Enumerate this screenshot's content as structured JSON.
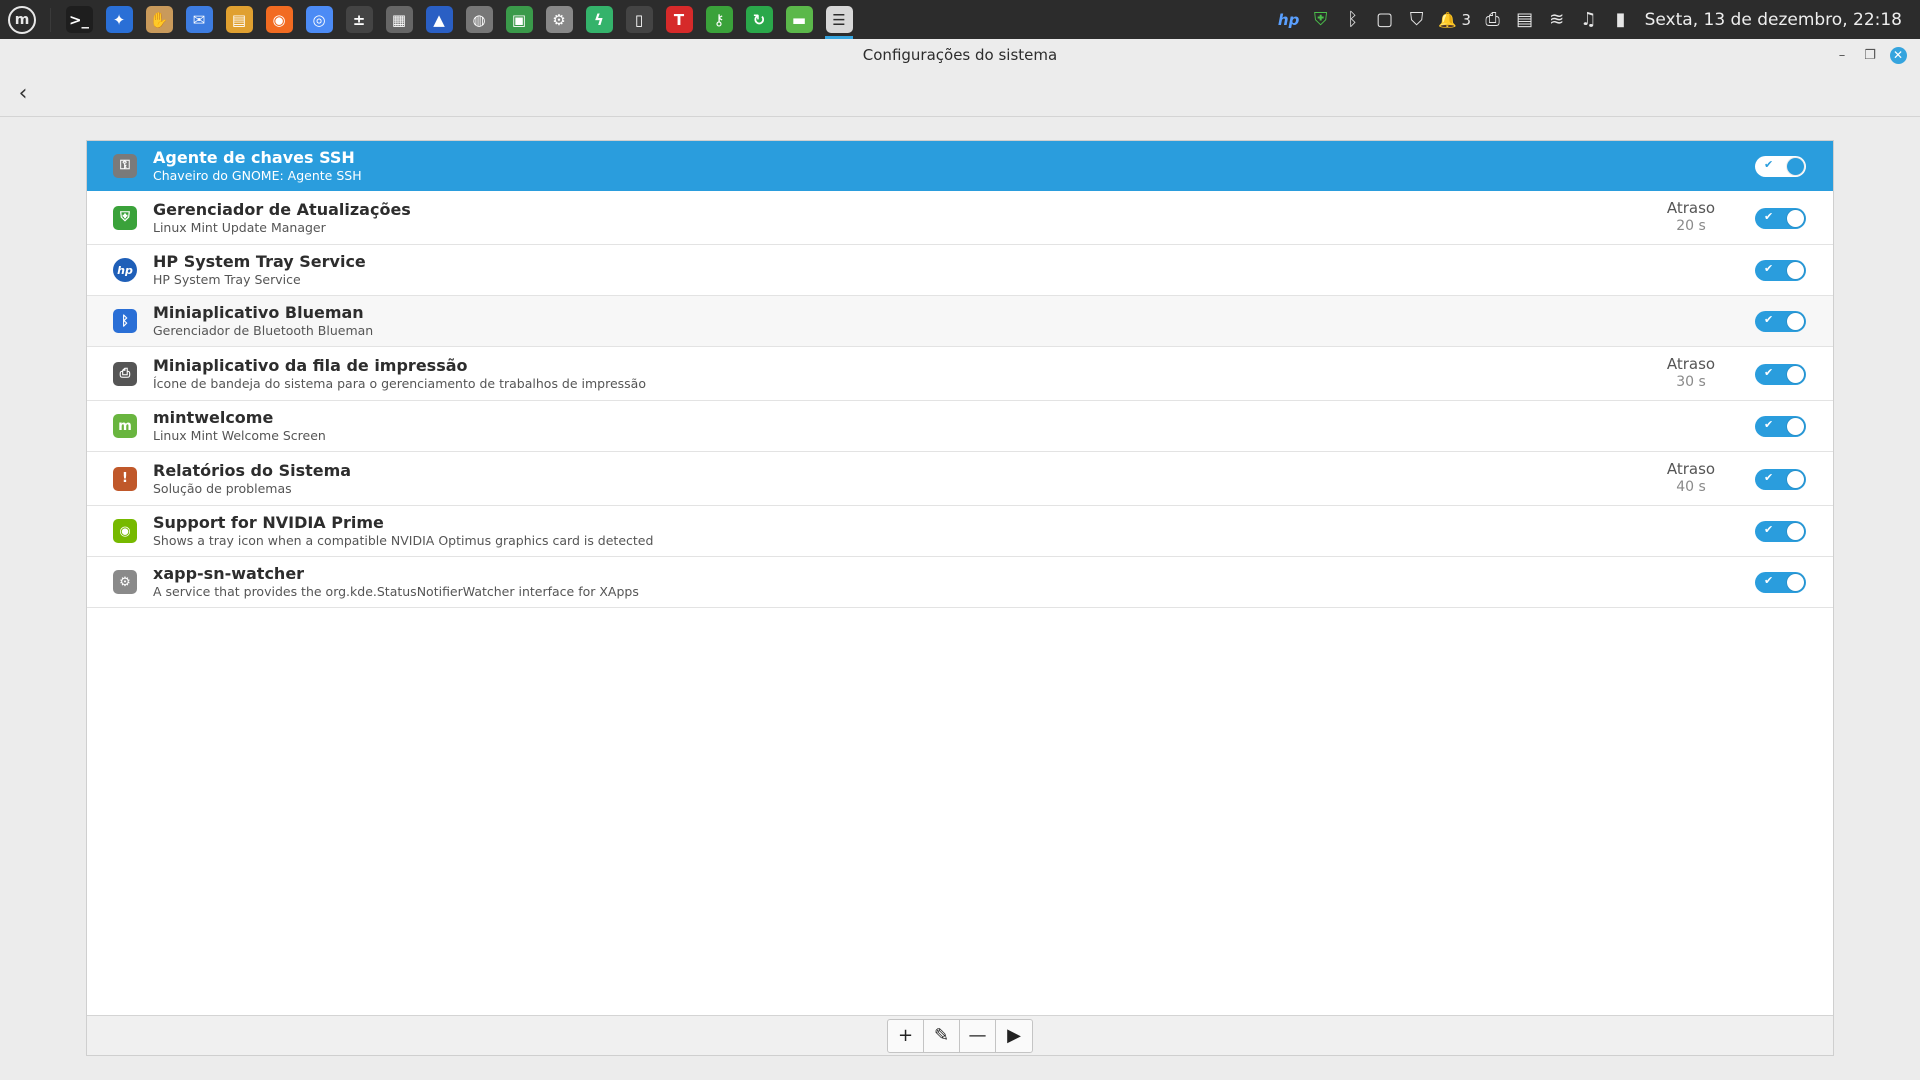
{
  "panel": {
    "menu_label": "m",
    "launchers": [
      {
        "icon": "terminal-icon",
        "glyph": ">_",
        "color": "#1e1e1e"
      },
      {
        "icon": "accessibility-icon",
        "glyph": "✦",
        "color": "#2a6fd6"
      },
      {
        "icon": "hand-app-icon",
        "glyph": "✋",
        "color": "#c99a5b"
      },
      {
        "icon": "mail-icon",
        "glyph": "✉",
        "color": "#3d7ce0"
      },
      {
        "icon": "document-viewer-icon",
        "glyph": "▤",
        "color": "#e0a030"
      },
      {
        "icon": "firefox-icon",
        "glyph": "◉",
        "color": "#f26b21"
      },
      {
        "icon": "chrome-icon",
        "glyph": "◎",
        "color": "#4c8bf5"
      },
      {
        "icon": "calculator-icon",
        "glyph": "±",
        "color": "#444444"
      },
      {
        "icon": "printer-stack-icon",
        "glyph": "▦",
        "color": "#666666"
      },
      {
        "icon": "image-app-icon",
        "glyph": "▲",
        "color": "#2a5fc4"
      },
      {
        "icon": "webcam-icon",
        "glyph": "◍",
        "color": "#777777"
      },
      {
        "icon": "photos-icon",
        "glyph": "▣",
        "color": "#3a9a4a"
      },
      {
        "icon": "settings-gear-icon",
        "glyph": "⚙",
        "color": "#888888"
      },
      {
        "icon": "lightning-app-icon",
        "glyph": "ϟ",
        "color": "#34b36b"
      },
      {
        "icon": "mobile-app-icon",
        "glyph": "▯",
        "color": "#444444"
      },
      {
        "icon": "font-app-icon",
        "glyph": "T",
        "color": "#d62a2a"
      },
      {
        "icon": "keys-app-icon",
        "glyph": "⚷",
        "color": "#3aa23a"
      },
      {
        "icon": "refresh-app-icon",
        "glyph": "↻",
        "color": "#2aa84a"
      },
      {
        "icon": "folder-icon",
        "glyph": "▬",
        "color": "#5bb84a"
      },
      {
        "icon": "startup-apps-icon",
        "glyph": "☰",
        "color": "#d8d8d8",
        "active": true
      }
    ],
    "tray": [
      {
        "icon": "hp-tray-icon",
        "glyph": "hp"
      },
      {
        "icon": "update-manager-tray-icon",
        "glyph": "⛨"
      },
      {
        "icon": "bluetooth-icon",
        "glyph": "ᛒ"
      },
      {
        "icon": "clipboard-icon",
        "glyph": "▢"
      },
      {
        "icon": "shield-icon",
        "glyph": "⛉"
      },
      {
        "icon": "notifications-icon",
        "glyph": "🔔 3"
      },
      {
        "icon": "printer-icon",
        "glyph": "⎙"
      },
      {
        "icon": "drive-icon",
        "glyph": "▤"
      },
      {
        "icon": "wifi-icon",
        "glyph": "≋"
      },
      {
        "icon": "sound-icon",
        "glyph": "♫"
      },
      {
        "icon": "power-icon",
        "glyph": "▮"
      }
    ],
    "clock": "Sexta, 13 de dezembro, 22:18"
  },
  "window": {
    "title": "Configurações do sistema",
    "minimize": "–",
    "maximize": "❐",
    "close": "✕"
  },
  "toolbar": {
    "back": "‹"
  },
  "startup_apps": [
    {
      "name": "Agente de chaves SSH",
      "desc": "Chaveiro do GNOME: Agente SSH",
      "icon": "ssh-agent-icon",
      "glyph": "⚿",
      "icon_color": "#7a7a7a",
      "delay_label": "",
      "delay_value": "",
      "enabled": true,
      "selected": true
    },
    {
      "name": "Gerenciador de Atualizações",
      "desc": "Linux Mint Update Manager",
      "icon": "update-shield-icon",
      "glyph": "⛨",
      "icon_color": "#3aa23a",
      "delay_label": "Atraso",
      "delay_value": "20 s",
      "enabled": true,
      "selected": false
    },
    {
      "name": "HP System Tray Service",
      "desc": "HP System Tray Service",
      "icon": "hp-logo-icon",
      "glyph": "hp",
      "icon_color": "#1f5fb8",
      "delay_label": "",
      "delay_value": "",
      "enabled": true,
      "selected": false
    },
    {
      "name": "Miniaplicativo Blueman",
      "desc": "Gerenciador de Bluetooth Blueman",
      "icon": "bluetooth-icon",
      "glyph": "ᛒ",
      "icon_color": "#2a6fd6",
      "delay_label": "",
      "delay_value": "",
      "enabled": true,
      "selected": false,
      "tint": true
    },
    {
      "name": "Miniaplicativo da fila de impressão",
      "desc": "Ícone de bandeja do sistema para o gerenciamento de trabalhos de impressão",
      "icon": "printer-icon",
      "glyph": "⎙",
      "icon_color": "#555555",
      "delay_label": "Atraso",
      "delay_value": "30 s",
      "enabled": true,
      "selected": false
    },
    {
      "name": "mintwelcome",
      "desc": "Linux Mint Welcome Screen",
      "icon": "mint-welcome-icon",
      "glyph": "m",
      "icon_color": "#69b53f",
      "delay_label": "",
      "delay_value": "",
      "enabled": true,
      "selected": false
    },
    {
      "name": "Relatórios do Sistema",
      "desc": "Solução de problemas",
      "icon": "system-reports-icon",
      "glyph": "!",
      "icon_color": "#c0582a",
      "delay_label": "Atraso",
      "delay_value": "40 s",
      "enabled": true,
      "selected": false
    },
    {
      "name": "Support for NVIDIA Prime",
      "desc": "Shows a tray icon when a compatible NVIDIA Optimus graphics card is detected",
      "icon": "nvidia-icon",
      "glyph": "◉",
      "icon_color": "#76b900",
      "delay_label": "",
      "delay_value": "",
      "enabled": true,
      "selected": false
    },
    {
      "name": "xapp-sn-watcher",
      "desc": "A service that provides the org.kde.StatusNotifierWatcher interface for XApps",
      "icon": "gears-icon",
      "glyph": "⚙",
      "icon_color": "#8a8a8a",
      "delay_label": "",
      "delay_value": "",
      "enabled": true,
      "selected": false
    }
  ],
  "actions": {
    "add": "+",
    "edit": "✎",
    "remove": "—",
    "run": "▶"
  },
  "colors": {
    "accent": "#2a9ddd",
    "panel_bg": "#2c2c2c"
  }
}
